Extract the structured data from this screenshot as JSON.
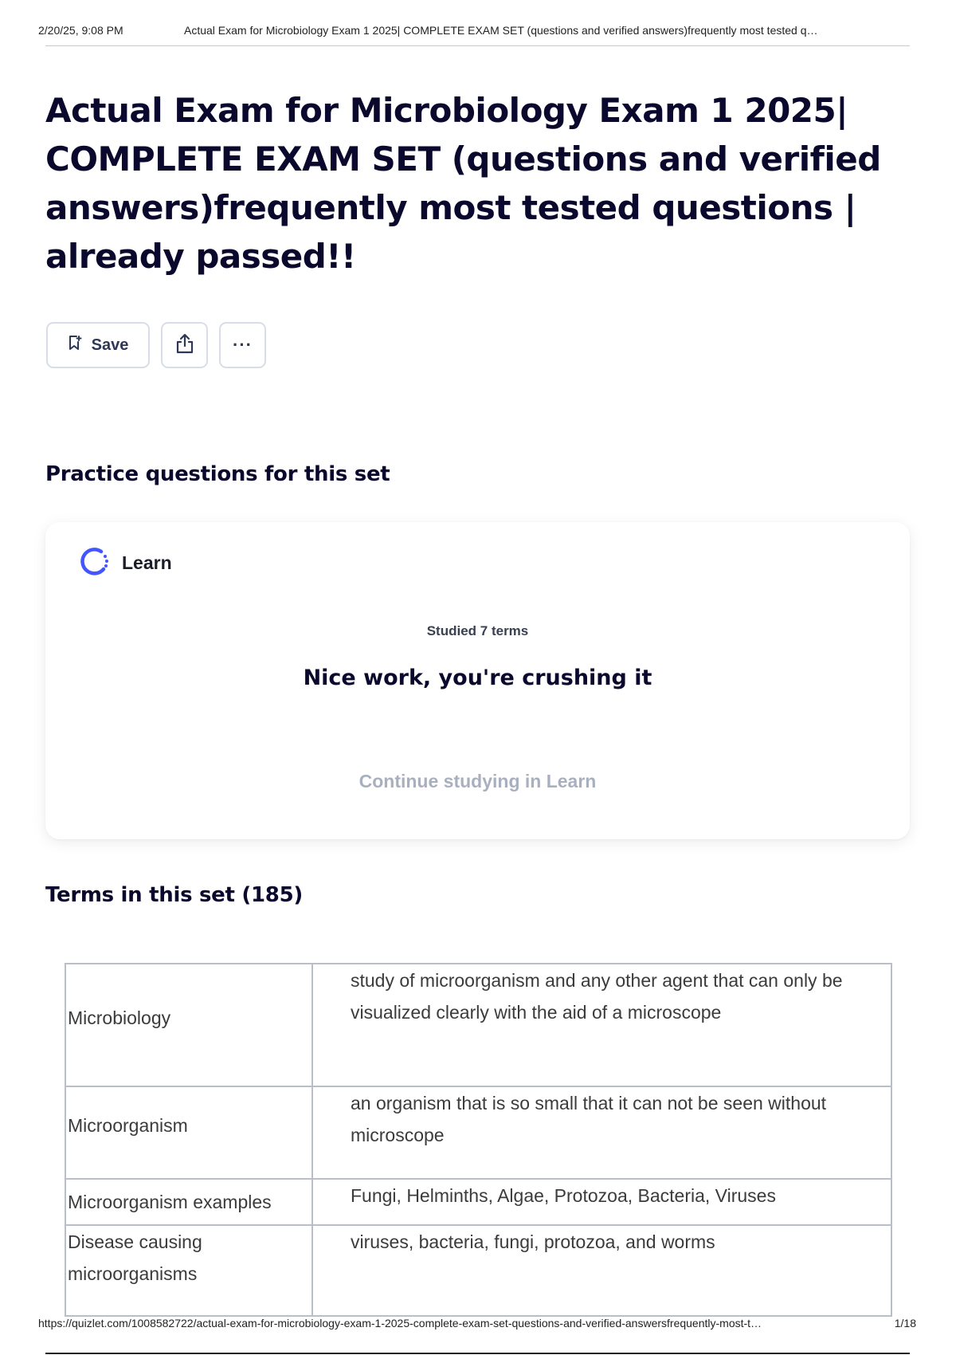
{
  "print_header": {
    "datetime": "2/20/25, 9:08 PM",
    "doc_title": "Actual Exam for Microbiology Exam 1 2025| COMPLETE EXAM SET (questions and verified answers)frequently most tested q…"
  },
  "page_title": "Actual Exam for Microbiology Exam 1 2025| COMPLETE EXAM SET (questions and verified answers)frequently most tested questions | already passed!!",
  "actions": {
    "save_label": "Save",
    "save_icon": "bookmark-icon",
    "share_icon": "share-icon",
    "more_icon": "more-icon",
    "more_glyph": "···"
  },
  "practice": {
    "heading": "Practice questions for this set",
    "card": {
      "mode_label": "Learn",
      "mode_icon": "learn-progress-icon",
      "studied_text": "Studied 7 terms",
      "message": "Nice work, you're crushing it",
      "continue_label": "Continue studying in Learn"
    }
  },
  "terms": {
    "heading": "Terms in this set (185)",
    "rows": [
      {
        "term": "Microbiology",
        "definition": "study of microorganism and any other agent that can only be visualized clearly with the aid of a microscope"
      },
      {
        "term": "Microorganism",
        "definition": "an organism that is so small that it can not be seen without microscope"
      },
      {
        "term": "Microorganism examples",
        "definition": "Fungi, Helminths, Algae, Protozoa, Bacteria, Viruses"
      },
      {
        "term": "Disease causing microorganisms",
        "definition": "viruses, bacteria, fungi, protozoa, and worms"
      }
    ]
  },
  "footer": {
    "url": "https://quizlet.com/1008582722/actual-exam-for-microbiology-exam-1-2025-complete-exam-set-questions-and-verified-answersfrequently-most-t…",
    "page_indicator": "1/18"
  },
  "colors": {
    "title_text": "#0a092d",
    "learn_accent": "#4255ff",
    "muted_link": "#a8b0c0",
    "border": "#d9dde8"
  }
}
